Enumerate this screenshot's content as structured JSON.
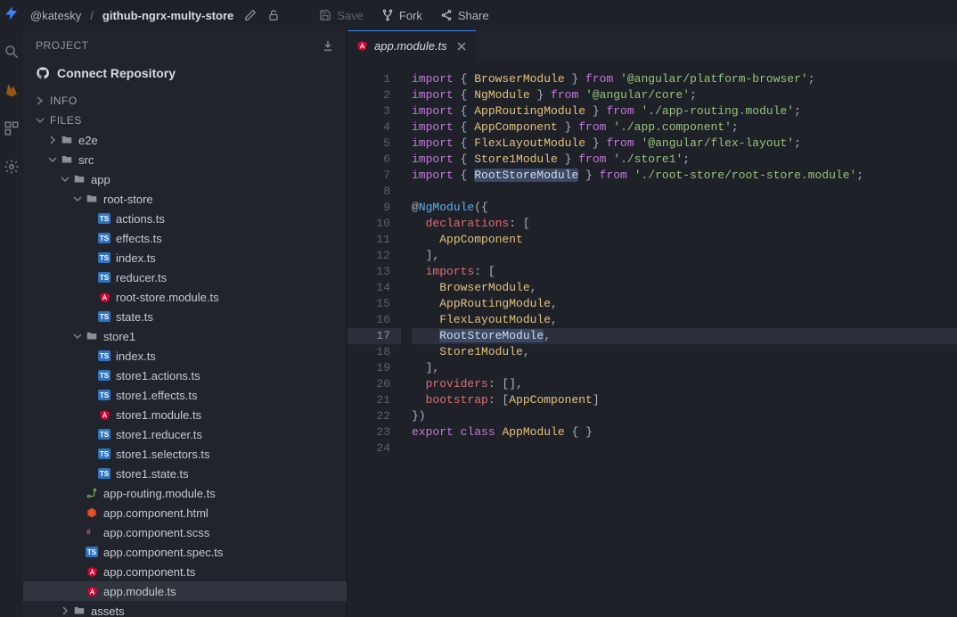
{
  "topbar": {
    "owner": "@katesky",
    "separator": "/",
    "project": "github-ngrx-multy-store",
    "save_label": "Save",
    "fork_label": "Fork",
    "share_label": "Share"
  },
  "sidebar": {
    "project_label": "PROJECT",
    "connect_repo_label": "Connect Repository",
    "info_label": "INFO",
    "files_label": "FILES",
    "tree": [
      {
        "depth": 0,
        "type": "folder",
        "expanded": false,
        "name": "e2e"
      },
      {
        "depth": 0,
        "type": "folder",
        "expanded": true,
        "name": "src"
      },
      {
        "depth": 1,
        "type": "folder",
        "expanded": true,
        "name": "app"
      },
      {
        "depth": 2,
        "type": "folder",
        "expanded": true,
        "name": "root-store"
      },
      {
        "depth": 3,
        "type": "file",
        "icon": "ts",
        "name": "actions.ts"
      },
      {
        "depth": 3,
        "type": "file",
        "icon": "ts",
        "name": "effects.ts"
      },
      {
        "depth": 3,
        "type": "file",
        "icon": "ts",
        "name": "index.ts"
      },
      {
        "depth": 3,
        "type": "file",
        "icon": "ts",
        "name": "reducer.ts"
      },
      {
        "depth": 3,
        "type": "file",
        "icon": "angular",
        "name": "root-store.module.ts"
      },
      {
        "depth": 3,
        "type": "file",
        "icon": "ts",
        "name": "state.ts"
      },
      {
        "depth": 2,
        "type": "folder",
        "expanded": true,
        "name": "store1"
      },
      {
        "depth": 3,
        "type": "file",
        "icon": "ts",
        "name": "index.ts"
      },
      {
        "depth": 3,
        "type": "file",
        "icon": "ts",
        "name": "store1.actions.ts"
      },
      {
        "depth": 3,
        "type": "file",
        "icon": "ts",
        "name": "store1.effects.ts"
      },
      {
        "depth": 3,
        "type": "file",
        "icon": "angular",
        "name": "store1.module.ts"
      },
      {
        "depth": 3,
        "type": "file",
        "icon": "ts",
        "name": "store1.reducer.ts"
      },
      {
        "depth": 3,
        "type": "file",
        "icon": "ts",
        "name": "store1.selectors.ts"
      },
      {
        "depth": 3,
        "type": "file",
        "icon": "ts",
        "name": "store1.state.ts"
      },
      {
        "depth": 2,
        "type": "file",
        "icon": "route",
        "name": "app-routing.module.ts"
      },
      {
        "depth": 2,
        "type": "file",
        "icon": "html",
        "name": "app.component.html"
      },
      {
        "depth": 2,
        "type": "file",
        "icon": "scss",
        "name": "app.component.scss"
      },
      {
        "depth": 2,
        "type": "file",
        "icon": "ts",
        "name": "app.component.spec.ts"
      },
      {
        "depth": 2,
        "type": "file",
        "icon": "angular",
        "name": "app.component.ts"
      },
      {
        "depth": 2,
        "type": "file",
        "icon": "angular",
        "name": "app.module.ts",
        "selected": true
      },
      {
        "depth": 1,
        "type": "folder",
        "expanded": false,
        "name": "assets"
      }
    ]
  },
  "editor": {
    "tab": {
      "filename": "app.module.ts"
    },
    "current_line": 17,
    "lines": [
      {
        "n": 1,
        "segments": [
          [
            "kw",
            "import"
          ],
          [
            "punc",
            " { "
          ],
          [
            "type",
            "BrowserModule"
          ],
          [
            "punc",
            " } "
          ],
          [
            "kw",
            "from"
          ],
          [
            "punc",
            " "
          ],
          [
            "str",
            "'@angular/platform-browser'"
          ],
          [
            "punc",
            ";"
          ]
        ]
      },
      {
        "n": 2,
        "segments": [
          [
            "kw",
            "import"
          ],
          [
            "punc",
            " { "
          ],
          [
            "type",
            "NgModule"
          ],
          [
            "punc",
            " } "
          ],
          [
            "kw",
            "from"
          ],
          [
            "punc",
            " "
          ],
          [
            "str",
            "'@angular/core'"
          ],
          [
            "punc",
            ";"
          ]
        ]
      },
      {
        "n": 3,
        "segments": [
          [
            "kw",
            "import"
          ],
          [
            "punc",
            " { "
          ],
          [
            "type",
            "AppRoutingModule"
          ],
          [
            "punc",
            " } "
          ],
          [
            "kw",
            "from"
          ],
          [
            "punc",
            " "
          ],
          [
            "str",
            "'./app-routing.module'"
          ],
          [
            "punc",
            ";"
          ]
        ]
      },
      {
        "n": 4,
        "segments": [
          [
            "kw",
            "import"
          ],
          [
            "punc",
            " { "
          ],
          [
            "type",
            "AppComponent"
          ],
          [
            "punc",
            " } "
          ],
          [
            "kw",
            "from"
          ],
          [
            "punc",
            " "
          ],
          [
            "str",
            "'./app.component'"
          ],
          [
            "punc",
            ";"
          ]
        ]
      },
      {
        "n": 5,
        "segments": [
          [
            "kw",
            "import"
          ],
          [
            "punc",
            " { "
          ],
          [
            "type",
            "FlexLayoutModule"
          ],
          [
            "punc",
            " } "
          ],
          [
            "kw",
            "from"
          ],
          [
            "punc",
            " "
          ],
          [
            "str",
            "'@angular/flex-layout'"
          ],
          [
            "punc",
            ";"
          ]
        ]
      },
      {
        "n": 6,
        "segments": [
          [
            "kw",
            "import"
          ],
          [
            "punc",
            " { "
          ],
          [
            "type",
            "Store1Module"
          ],
          [
            "punc",
            " } "
          ],
          [
            "kw",
            "from"
          ],
          [
            "punc",
            " "
          ],
          [
            "str",
            "'./store1'"
          ],
          [
            "punc",
            ";"
          ]
        ]
      },
      {
        "n": 7,
        "segments": [
          [
            "kw",
            "import"
          ],
          [
            "punc",
            " { "
          ],
          [
            "sel",
            "RootStoreModule"
          ],
          [
            "punc",
            " } "
          ],
          [
            "kw",
            "from"
          ],
          [
            "punc",
            " "
          ],
          [
            "str",
            "'./root-store/root-store.module'"
          ],
          [
            "punc",
            ";"
          ]
        ]
      },
      {
        "n": 8,
        "segments": []
      },
      {
        "n": 9,
        "segments": [
          [
            "punc",
            "@"
          ],
          [
            "dec",
            "NgModule"
          ],
          [
            "punc",
            "({"
          ]
        ]
      },
      {
        "n": 10,
        "segments": [
          [
            "punc",
            "  "
          ],
          [
            "prop",
            "declarations"
          ],
          [
            "punc",
            ": ["
          ]
        ]
      },
      {
        "n": 11,
        "segments": [
          [
            "punc",
            "    "
          ],
          [
            "type",
            "AppComponent"
          ]
        ]
      },
      {
        "n": 12,
        "segments": [
          [
            "punc",
            "  ],"
          ]
        ]
      },
      {
        "n": 13,
        "segments": [
          [
            "punc",
            "  "
          ],
          [
            "prop",
            "imports"
          ],
          [
            "punc",
            ": ["
          ]
        ]
      },
      {
        "n": 14,
        "segments": [
          [
            "punc",
            "    "
          ],
          [
            "type",
            "BrowserModule"
          ],
          [
            "punc",
            ","
          ]
        ]
      },
      {
        "n": 15,
        "segments": [
          [
            "punc",
            "    "
          ],
          [
            "type",
            "AppRoutingModule"
          ],
          [
            "punc",
            ","
          ]
        ]
      },
      {
        "n": 16,
        "segments": [
          [
            "punc",
            "    "
          ],
          [
            "type",
            "FlexLayoutModule"
          ],
          [
            "punc",
            ","
          ]
        ]
      },
      {
        "n": 17,
        "segments": [
          [
            "punc",
            "    "
          ],
          [
            "sel",
            "RootStoreModule"
          ],
          [
            "punc",
            ","
          ]
        ]
      },
      {
        "n": 18,
        "segments": [
          [
            "punc",
            "    "
          ],
          [
            "type",
            "Store1Module"
          ],
          [
            "punc",
            ","
          ]
        ]
      },
      {
        "n": 19,
        "segments": [
          [
            "punc",
            "  ],"
          ]
        ]
      },
      {
        "n": 20,
        "segments": [
          [
            "punc",
            "  "
          ],
          [
            "prop",
            "providers"
          ],
          [
            "punc",
            ": [],"
          ]
        ]
      },
      {
        "n": 21,
        "segments": [
          [
            "punc",
            "  "
          ],
          [
            "prop",
            "bootstrap"
          ],
          [
            "punc",
            ": ["
          ],
          [
            "type",
            "AppComponent"
          ],
          [
            "punc",
            "]"
          ]
        ]
      },
      {
        "n": 22,
        "segments": [
          [
            "punc",
            "})"
          ]
        ]
      },
      {
        "n": 23,
        "segments": [
          [
            "kw",
            "export"
          ],
          [
            "punc",
            " "
          ],
          [
            "kw",
            "class"
          ],
          [
            "punc",
            " "
          ],
          [
            "type",
            "AppModule"
          ],
          [
            "punc",
            " { }"
          ]
        ]
      },
      {
        "n": 24,
        "segments": []
      }
    ]
  }
}
